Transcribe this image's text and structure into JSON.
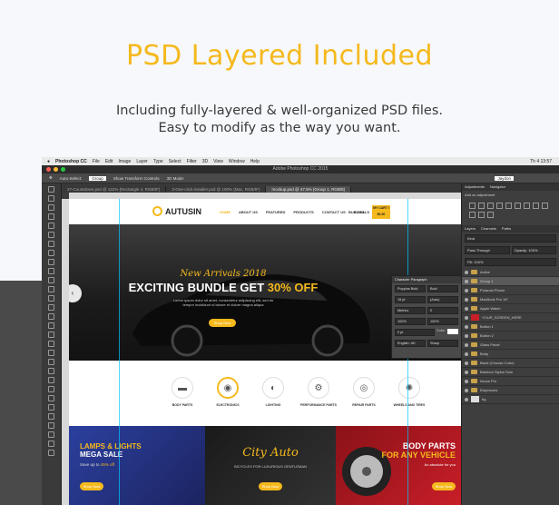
{
  "heading": "PSD Layered Included",
  "subheading_line1": "Including fully-layered & well-organized PSD files.",
  "subheading_line2": "Easy to modify as the way you want.",
  "colors": {
    "accent": "#f5b91d",
    "dark_band": "#4a4a4a",
    "page_bg": "#f6f8fc"
  },
  "mac_menu": [
    "Photoshop CC",
    "File",
    "Edit",
    "Image",
    "Layer",
    "Type",
    "Select",
    "Filter",
    "3D",
    "View",
    "Window",
    "Help"
  ],
  "mac_clock": "Th 4 13:57",
  "window_title": "Adobe Photoshop CC 2015",
  "options": {
    "auto_select": "Auto-Select:",
    "group": "Group",
    "transform": "Show Transform Controls",
    "mode": "3D Mode:",
    "workspace": "Jaydon"
  },
  "doc_tabs": [
    {
      "label": "27-Countdown.psd @ 122% (Rectangle 4, RGB/8*)",
      "active": false
    },
    {
      "label": "3-One-click-installer.psd @ 100% (Mac, RGB/8*)",
      "active": false
    },
    {
      "label": "mockup.psd @ 47.5% (Group 1, RGB/8)",
      "active": true
    }
  ],
  "site": {
    "logo": "AUTUSIN",
    "menu": [
      "HOME",
      "ABOUT US",
      "FEATURED",
      "PRODUCTS",
      "CONTACT US",
      "BLOG"
    ],
    "nav_right": "BUY DEALS",
    "cart": "MY CART / $0.00",
    "hero": {
      "tagline": "New Arrivals 2018",
      "title_a": "EXCITING BUNDLE GET ",
      "title_b": "30% OFF",
      "desc": "Lorem ipsum dolor sit amet, consectetur adipiscing elit, sed do tempor incididunt ut labore et dolore magna aliqua",
      "button": "Shop Now",
      "arrow": "‹"
    },
    "categories": [
      {
        "label": "BODY PARTS",
        "icon": "bumper-icon",
        "glyph": "▬",
        "selected": false
      },
      {
        "label": "ELECTRONICS",
        "icon": "speaker-icon",
        "glyph": "◉",
        "selected": true
      },
      {
        "label": "LIGHTING",
        "icon": "headlight-icon",
        "glyph": "◐",
        "selected": false
      },
      {
        "label": "PERFORMANCE PARTS",
        "icon": "turbo-icon",
        "glyph": "⚙",
        "selected": false
      },
      {
        "label": "REPAIR PARTS",
        "icon": "brake-icon",
        "glyph": "◎",
        "selected": false
      },
      {
        "label": "WHEELS AND TIRES",
        "icon": "wheel-icon",
        "glyph": "✺",
        "selected": false
      }
    ],
    "banners": {
      "b1": {
        "line1": "LAMPS & LIGHTS",
        "line2": "MEGA SALE",
        "line3a": "Save up to ",
        "line3b": "45% off",
        "button": "Shop Now"
      },
      "b2": {
        "line1": "City Auto",
        "line2": "BICYCLES FOR LUXURIOUS GENTLEMAN",
        "button": "Shop Now"
      },
      "b3": {
        "line1": "BODY PARTS",
        "line2": "FOR ANY VEHICLE",
        "line3": "An absolute for you",
        "button": "Shop Now"
      }
    }
  },
  "character_panel": {
    "title": "Character   Paragraph",
    "font": "Poppins Bold",
    "style": "Bold",
    "size": "15 pt",
    "leading": "(Auto)",
    "kerning": "Metrics",
    "tracking": "0",
    "vscale": "100%",
    "hscale": "100%",
    "baseline": "0 pt",
    "color_label": "Color:",
    "language": "English: UK",
    "aa": "Sharp"
  },
  "right_panels": {
    "adjustments_tabs": [
      "Adjustments",
      "Navigator"
    ],
    "adjustments_hint": "Add an adjustment",
    "layers_tabs": [
      "Layers",
      "Channels",
      "Paths"
    ],
    "kind": "Kind",
    "blend": "Pass Through",
    "opacity": "Opacity: 100%",
    "fill": "Fill: 100%",
    "layers": [
      {
        "name": "Active",
        "type": "folder",
        "active": false
      },
      {
        "name": "Group 1",
        "type": "folder",
        "active": true
      },
      {
        "name": "Polaroid Phone",
        "type": "folder",
        "active": false
      },
      {
        "name": "MacBook Pro 16\"",
        "type": "folder",
        "active": false
      },
      {
        "name": "Apple Watch",
        "type": "folder",
        "active": false
      },
      {
        "name": "YOUR_SCREEN_HERE",
        "type": "red",
        "active": false
      },
      {
        "name": "Button 1",
        "type": "folder",
        "active": false
      },
      {
        "name": "Button 2",
        "type": "folder",
        "active": false
      },
      {
        "name": "Glass Panel",
        "type": "folder",
        "active": false
      },
      {
        "name": "Body",
        "type": "folder",
        "active": false
      },
      {
        "name": "Band (Choose Color)",
        "type": "folder",
        "active": false
      },
      {
        "name": "Bamboo Stylus Solo",
        "type": "folder",
        "active": false
      },
      {
        "name": "Intuos Pro",
        "type": "folder",
        "active": false
      },
      {
        "name": "Earphones",
        "type": "folder",
        "active": false
      },
      {
        "name": "bg",
        "type": "thumb",
        "active": false
      }
    ]
  }
}
